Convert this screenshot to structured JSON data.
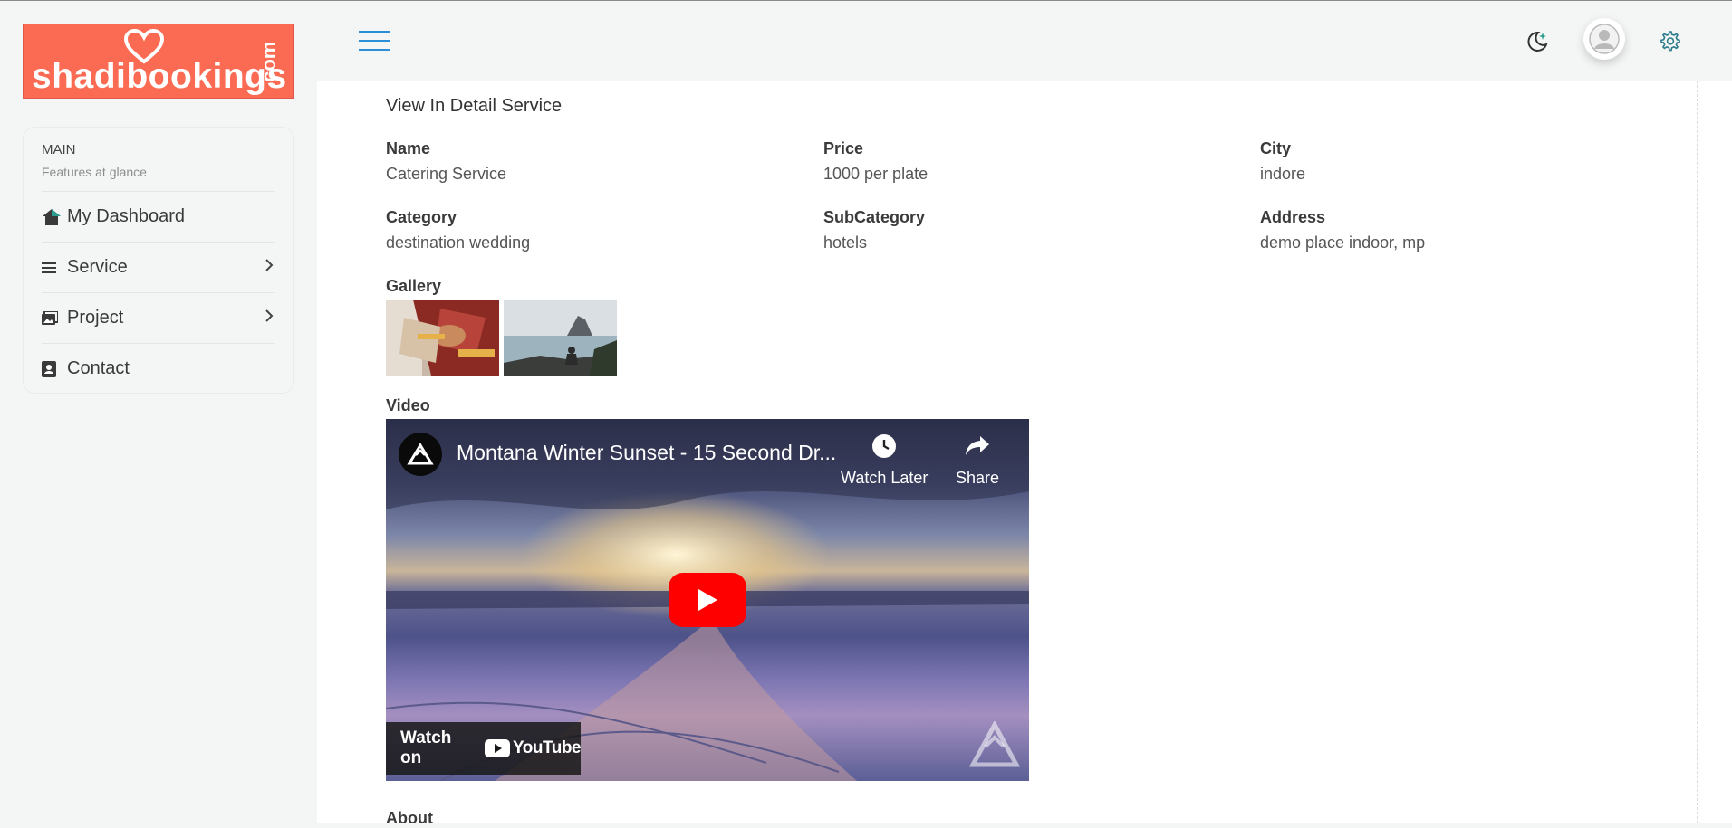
{
  "brand": {
    "name": "shadibookings",
    "suffix": ".com",
    "bg_color": "#fb6a52"
  },
  "sidebar": {
    "section_title": "MAIN",
    "section_subtitle": "Features at glance",
    "items": [
      {
        "label": "My Dashboard",
        "icon": "home-icon",
        "has_submenu": false
      },
      {
        "label": "Service",
        "icon": "list-icon",
        "has_submenu": true
      },
      {
        "label": "Project",
        "icon": "images-icon",
        "has_submenu": true
      },
      {
        "label": "Contact",
        "icon": "contact-book-icon",
        "has_submenu": false
      }
    ]
  },
  "header": {
    "menu_icon": "hamburger-icon",
    "theme_icon": "moon-icon",
    "user_icon": "user-avatar-icon",
    "settings_icon": "gear-icon",
    "accent_color": "#2a8fd6"
  },
  "detail": {
    "title": "View In Detail Service",
    "fields": {
      "name": {
        "label": "Name",
        "value": "Catering Service"
      },
      "price": {
        "label": "Price",
        "value": "1000 per plate"
      },
      "city": {
        "label": "City",
        "value": "indore"
      },
      "category": {
        "label": "Category",
        "value": "destination wedding"
      },
      "subcategory": {
        "label": "SubCategory",
        "value": "hotels"
      },
      "address": {
        "label": "Address",
        "value": "demo place indoor, mp"
      }
    },
    "gallery_label": "Gallery",
    "gallery": [
      "wedding-hands-photo",
      "person-sitting-by-sea-photo"
    ],
    "video_label": "Video",
    "about_label": "About"
  },
  "video": {
    "title": "Montana Winter Sunset - 15 Second Dr...",
    "watch_later": "Watch Later",
    "share": "Share",
    "watch_on": "Watch on",
    "youtube": "YouTube",
    "play_color": "#ff0000"
  }
}
